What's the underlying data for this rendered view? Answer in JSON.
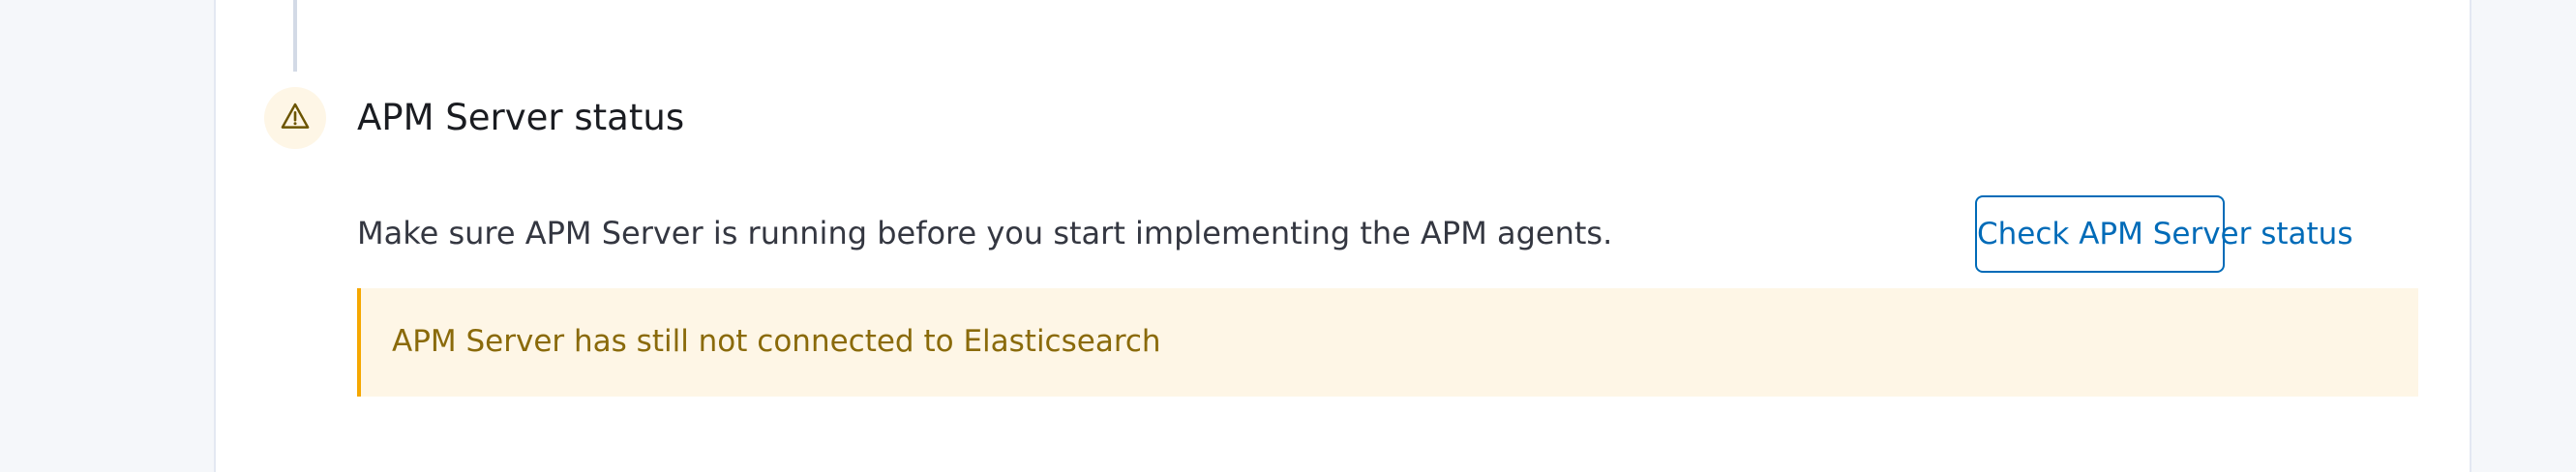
{
  "step": {
    "title": "APM Server status",
    "status_icon": "warning-icon",
    "description": "Make sure APM Server is running before you start implementing the APM agents.",
    "check_button_label": "Check APM Server status"
  },
  "callout": {
    "message": "APM Server has still not connected to Elasticsearch",
    "type": "warning"
  },
  "colors": {
    "primary": "#006bb8",
    "warning_accent": "#f5a700",
    "warning_background": "#fef6e6",
    "warning_text": "#8a6a0a",
    "title_text": "#1a1c21",
    "body_text": "#343741"
  }
}
